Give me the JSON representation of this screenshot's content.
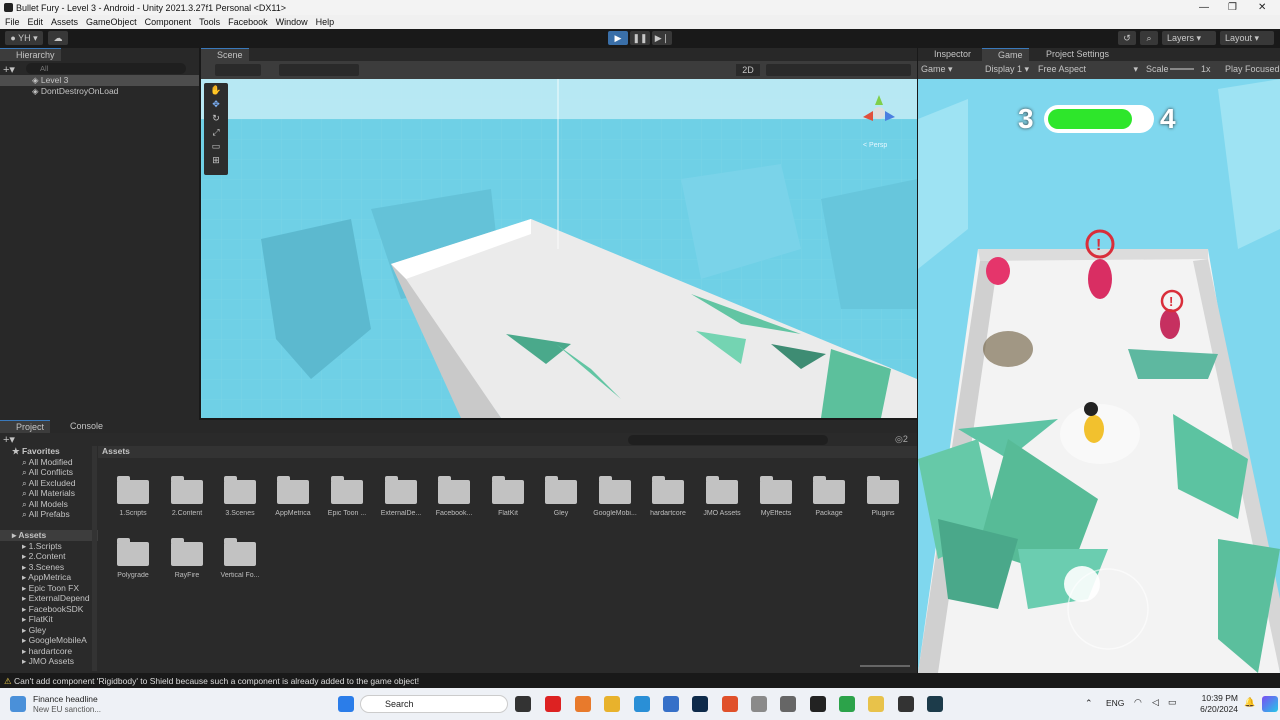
{
  "window": {
    "title": "Bullet Fury - Level 3 - Android - Unity 2021.3.27f1 Personal <DX11>"
  },
  "menu": [
    "File",
    "Edit",
    "Assets",
    "GameObject",
    "Component",
    "Tools",
    "Facebook",
    "Window",
    "Help"
  ],
  "toolbar": {
    "account": "YH",
    "layers": "Layers",
    "layout": "Layout"
  },
  "hierarchy": {
    "tab": "Hierarchy",
    "search_placeholder": "All",
    "items": [
      "Level 3",
      "DontDestroyOnLoad"
    ]
  },
  "scene": {
    "tab": "Scene",
    "mode_2d": "2D",
    "persp": "< Persp"
  },
  "right_tabs": [
    "Inspector",
    "Game",
    "Project Settings"
  ],
  "game_bar": {
    "display_mode": "Game",
    "display": "Display 1",
    "aspect": "Free Aspect",
    "scale_label": "Scale",
    "scale_value": "1x",
    "play_focused": "Play Focused"
  },
  "game_hud": {
    "left_score": "3",
    "right_score": "4",
    "health_fraction": 0.82,
    "bar_color": "#2ee62b"
  },
  "project": {
    "tabs": [
      "Project",
      "Console"
    ],
    "favorites_label": "Favorites",
    "favorites": [
      "All Modified",
      "All Conflicts",
      "All Excluded",
      "All Materials",
      "All Models",
      "All Prefabs"
    ],
    "assets_label": "Assets",
    "tree": [
      "1.Scripts",
      "2.Content",
      "3.Scenes",
      "AppMetrica",
      "Epic Toon FX",
      "ExternalDepend",
      "FacebookSDK",
      "FlatKit",
      "Gley",
      "GoogleMobileA",
      "hardartcore",
      "JMO Assets"
    ],
    "breadcrumb": "Assets",
    "folders": [
      "1.Scripts",
      "2.Content",
      "3.Scenes",
      "AppMetrica",
      "Epic Toon ...",
      "ExternalDe...",
      "Facebook...",
      "FlatKit",
      "Gley",
      "GoogleMobi...",
      "hardartcore",
      "JMO Assets",
      "MyEffects",
      "Package",
      "Plugins",
      "Polygrade",
      "RayFire",
      "Vertical Fo..."
    ],
    "count_badge": "2"
  },
  "status": {
    "message": "Can't add component 'Rigidbody' to Shield because such a component is already added to the game object!"
  },
  "taskbar": {
    "news_title": "Finance headline",
    "news_sub": "New EU sanction...",
    "search": "Search",
    "lang": "ENG",
    "time": "10:39 PM",
    "date": "6/20/2024"
  }
}
